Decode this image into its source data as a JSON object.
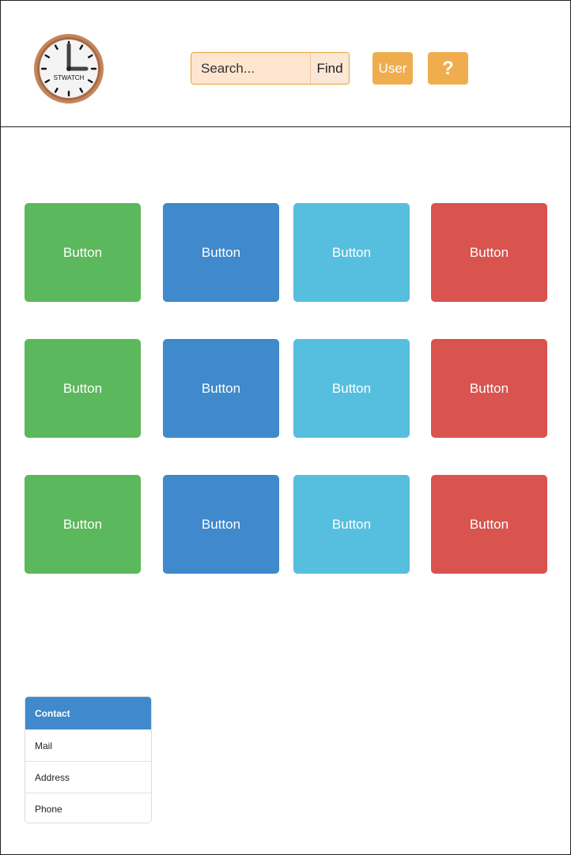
{
  "header": {
    "logo_text": "STWATCH",
    "search": {
      "placeholder": "Search...",
      "value": ""
    },
    "find_label": "Find",
    "user_label": "User",
    "help_label": "?"
  },
  "grid": {
    "buttons": [
      {
        "label": "Button",
        "color": "#5cb85c"
      },
      {
        "label": "Button",
        "color": "#3f89cc"
      },
      {
        "label": "Button",
        "color": "#56bfe0"
      },
      {
        "label": "Button",
        "color": "#d9534f"
      },
      {
        "label": "Button",
        "color": "#5cb85c"
      },
      {
        "label": "Button",
        "color": "#3f89cc"
      },
      {
        "label": "Button",
        "color": "#56bfe0"
      },
      {
        "label": "Button",
        "color": "#d9534f"
      },
      {
        "label": "Button",
        "color": "#5cb85c"
      },
      {
        "label": "Button",
        "color": "#3f89cc"
      },
      {
        "label": "Button",
        "color": "#56bfe0"
      },
      {
        "label": "Button",
        "color": "#d9534f"
      }
    ]
  },
  "contact": {
    "title": "Contact",
    "items": [
      "Mail",
      "Address",
      "Phone"
    ]
  },
  "colors": {
    "accent_orange": "#f0ad4e",
    "panel_blue": "#3f89cc"
  }
}
